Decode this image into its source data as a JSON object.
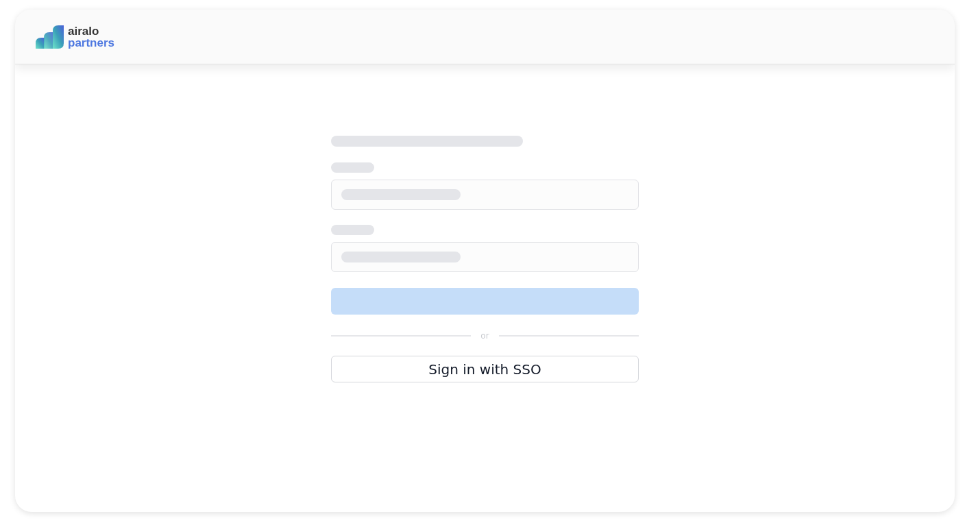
{
  "header": {
    "logo": {
      "brand": "airalo",
      "product": "partners"
    }
  },
  "form": {
    "skeleton": [
      {
        "kind": "title"
      },
      {
        "kind": "field"
      },
      {
        "kind": "field"
      },
      {
        "kind": "button"
      }
    ],
    "divider": "or",
    "sso_button": "Sign in with SSO"
  }
}
